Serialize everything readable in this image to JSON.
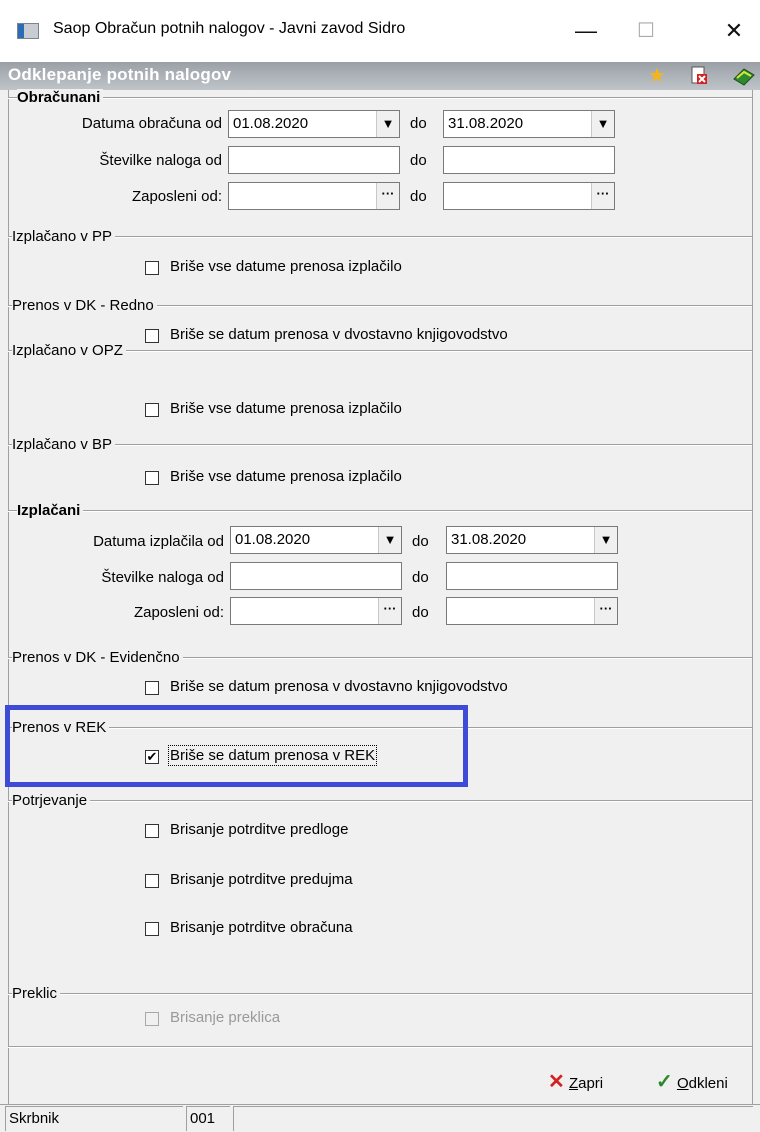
{
  "window": {
    "title": "Saop Obračun potnih nalogov - Javni zavod Sidro",
    "minimize": "—",
    "maximize": "☐",
    "close": "✕"
  },
  "header": {
    "title": "Odklepanje potnih nalogov",
    "icons": [
      "star-icon",
      "delete-document-icon",
      "book-run-icon"
    ]
  },
  "obracunani": {
    "title": "Obračunani",
    "date_label": "Datuma obračuna od",
    "date_from": "01.08.2020",
    "date_to": "31.08.2020",
    "numbers_label": "Številke naloga od",
    "numbers_from": "",
    "numbers_to": "",
    "employees_label": "Zaposleni od:",
    "employees_from": "",
    "employees_to": "",
    "to_label": "do"
  },
  "izplacano_pp": {
    "title": "Izplačano v PP",
    "checkbox": "Briše vse datume prenosa izplačilo",
    "checked": false
  },
  "prenos_dk_redno": {
    "title": "Prenos v DK - Redno",
    "checkbox": "Briše se datum prenosa v dvostavno knjigovodstvo",
    "checked": false
  },
  "izplacano_opz": {
    "title": "Izplačano v OPZ",
    "checkbox": "Briše vse datume prenosa izplačilo",
    "checked": false
  },
  "izplacano_bp": {
    "title": "Izplačano v BP",
    "checkbox": "Briše vse datume prenosa izplačilo",
    "checked": false
  },
  "izplacani": {
    "title": "Izplačani",
    "date_label": "Datuma izplačila od",
    "date_from": "01.08.2020",
    "date_to": "31.08.2020",
    "numbers_label": "Številke naloga od",
    "numbers_from": "",
    "numbers_to": "",
    "employees_label": "Zaposleni od:",
    "employees_from": "",
    "employees_to": "",
    "to_label": "do"
  },
  "prenos_dk_evidencno": {
    "title": "Prenos v DK - Evidenčno",
    "checkbox": "Briše se datum prenosa v dvostavno knjigovodstvo",
    "checked": false
  },
  "prenos_rek": {
    "title": "Prenos v REK",
    "checkbox": "Briše se datum prenosa v REK",
    "checked": true
  },
  "potrjevanje": {
    "title": "Potrjevanje",
    "items": [
      {
        "label": "Brisanje potrditve predloge",
        "checked": false
      },
      {
        "label": "Brisanje potrditve predujma",
        "checked": false
      },
      {
        "label": "Brisanje potrditve obračuna",
        "checked": false
      }
    ]
  },
  "preklic": {
    "title": "Preklic",
    "checkbox": "Brisanje preklica",
    "checked": false,
    "disabled": true
  },
  "buttons": {
    "close_mnemonic": "Z",
    "close_rest": "apri",
    "unlock_mnemonic": "O",
    "unlock_rest": "dkleni"
  },
  "status": {
    "user": "Skrbnik",
    "code": "001"
  },
  "colors": {
    "highlight": "#3d4bd6",
    "close_icon": "#d42020",
    "ok_icon": "#2a8a2a"
  }
}
